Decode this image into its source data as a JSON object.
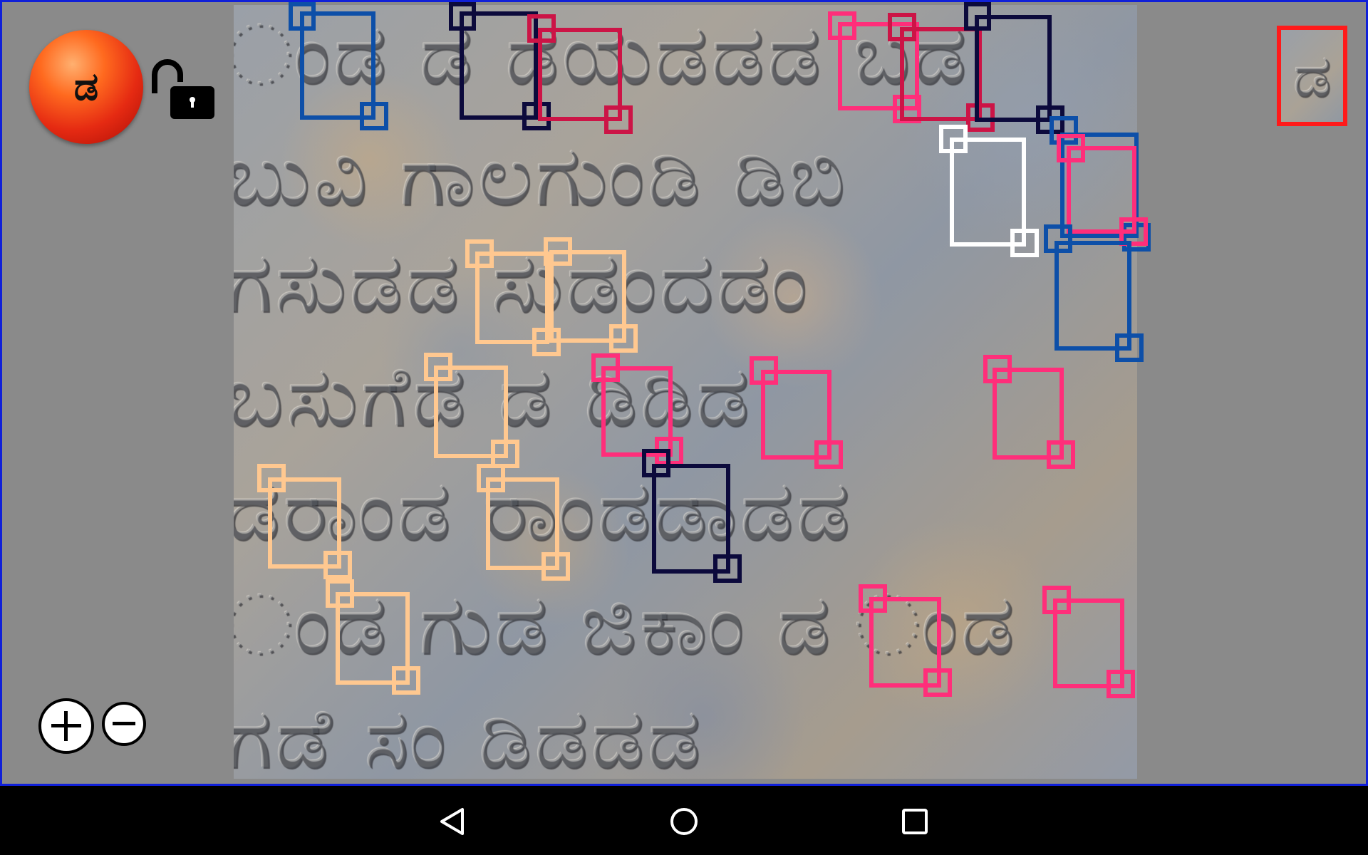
{
  "current_letter": {
    "glyph": "ಡ",
    "badge_color": "#e8361a"
  },
  "lock": {
    "icon": "unlocked-padlock-icon",
    "state": "unlocked"
  },
  "inscription": {
    "rows": [
      "ಂಡ ಡ ಡಯಡಡಡ ಬಡ",
      "ಬುವಿ ಗಾಲಗುಂಡಿ ಡಿಬಿ",
      "ಗಸುಡಡ ಸುಡಂದಡಂ",
      "ಬಸುಗೆಡ ಡ ಡಿಡಿಡ",
      "ಡರಾಂಡ ರಾಂಡಡಾಡಡ",
      "ಂಡ ಗುಡ ಜಿಕಾಂ ಡ ಂಡ",
      "ಗಡೆ ಸಂ ಡಿಡಡಡ"
    ]
  },
  "selection_colors": {
    "navy": "#0c0a3c",
    "blue": "#0d4fa8",
    "crimson": "#cc1446",
    "pink": "#ff2e7a",
    "peach": "#ffc890",
    "white": "#ffffff"
  },
  "reference_thumbnail": {
    "glyph": "ಡ",
    "border_color": "#ff1a1a"
  },
  "zoom": {
    "in_icon": "plus-icon",
    "out_icon": "minus-icon"
  },
  "navigation": {
    "back_icon": "back-triangle-icon",
    "home_icon": "home-circle-icon",
    "recents_icon": "recents-square-icon"
  }
}
